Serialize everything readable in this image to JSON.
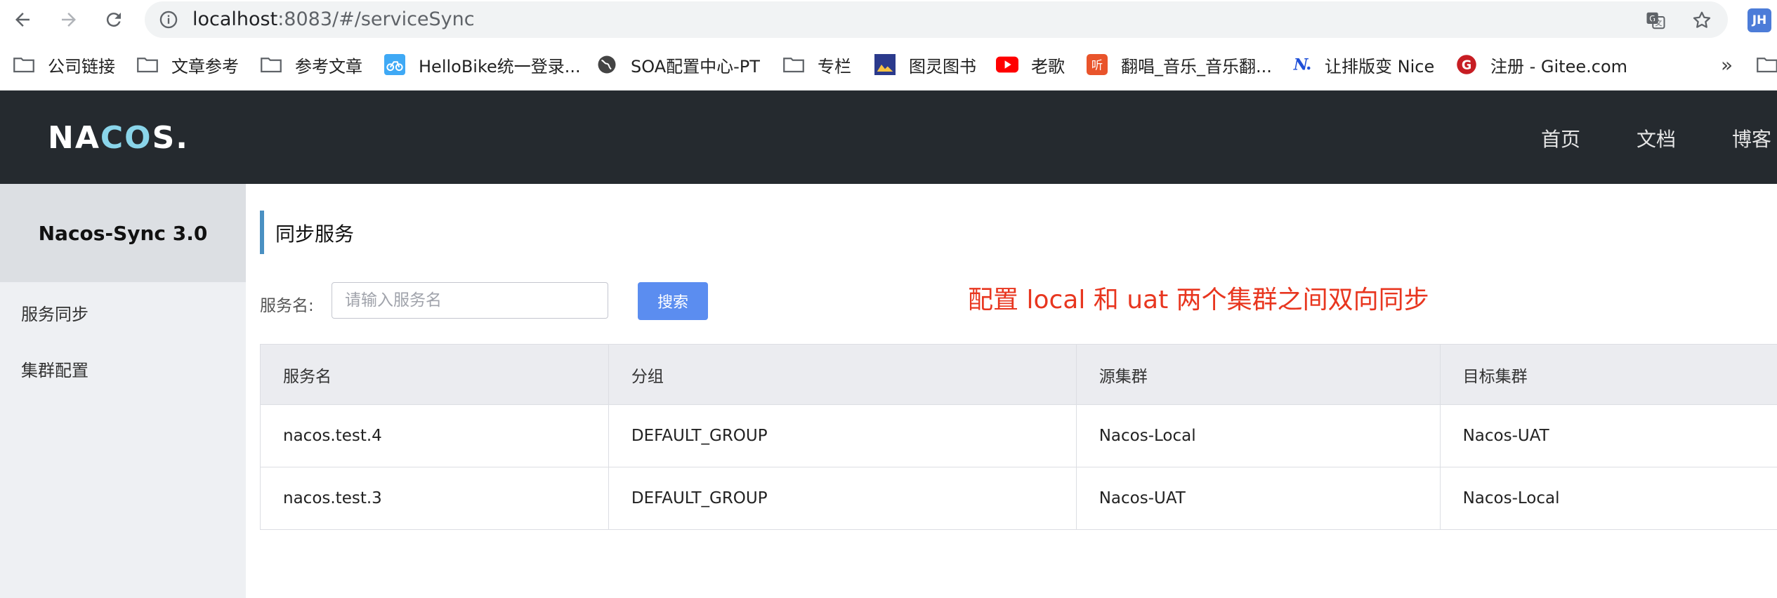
{
  "browser": {
    "url_host": "localhost",
    "url_path": ":8083/#/serviceSync",
    "profile_initials": "JH",
    "bookmarks": [
      {
        "label": "公司链接",
        "icon": "folder-icon"
      },
      {
        "label": "文章参考",
        "icon": "folder-icon"
      },
      {
        "label": "参考文章",
        "icon": "folder-icon"
      },
      {
        "label": "HelloBike统一登录...",
        "icon": "bike-icon"
      },
      {
        "label": "SOA配置中心-PT",
        "icon": "globe-icon"
      },
      {
        "label": "专栏",
        "icon": "folder-icon"
      },
      {
        "label": "图灵图书",
        "icon": "book-icon"
      },
      {
        "label": "老歌",
        "icon": "youtube-icon"
      },
      {
        "label": "翻唱_音乐_音乐翻...",
        "icon": "music-icon"
      },
      {
        "label": "让排版变 Nice",
        "icon": "nice-icon"
      },
      {
        "label": "注册 - Gitee.com",
        "icon": "gitee-icon"
      }
    ],
    "more_label": "»"
  },
  "header": {
    "logo_pre": "NA",
    "logo_co": "CO",
    "logo_post": "S.",
    "nav": [
      "首页",
      "文档",
      "博客"
    ]
  },
  "sidebar": {
    "title": "Nacos-Sync 3.0",
    "items": [
      "服务同步",
      "集群配置"
    ]
  },
  "main": {
    "title": "同步服务",
    "search_label": "服务名:",
    "search_placeholder": "请输入服务名",
    "search_button": "搜索",
    "annotation": "配置 local 和 uat 两个集群之间双向同步",
    "table": {
      "headers": [
        "服务名",
        "分组",
        "源集群",
        "目标集群"
      ],
      "rows": [
        [
          "nacos.test.4",
          "DEFAULT_GROUP",
          "Nacos-Local",
          "Nacos-UAT"
        ],
        [
          "nacos.test.3",
          "DEFAULT_GROUP",
          "Nacos-UAT",
          "Nacos-Local"
        ]
      ]
    }
  },
  "colors": {
    "header_bg": "#252a2f",
    "accent": "#5b8df0",
    "annotation": "#e8361f"
  }
}
